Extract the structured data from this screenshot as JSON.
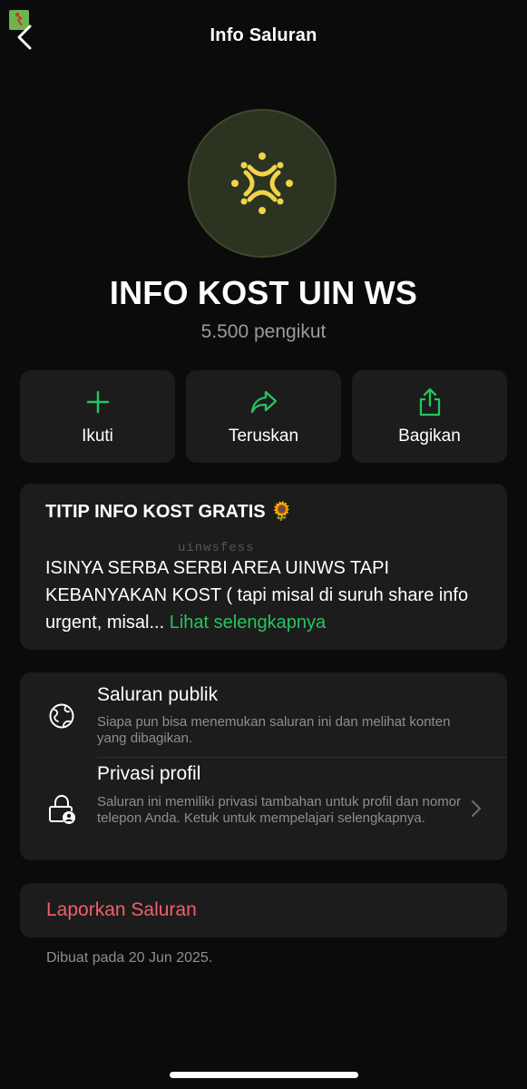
{
  "header": {
    "title": "Info Saluran"
  },
  "channel": {
    "name": "INFO KOST UIN WS",
    "followers": "5.500 pengikut"
  },
  "actions": [
    {
      "label": "Ikuti",
      "icon": "plus-icon"
    },
    {
      "label": "Teruskan",
      "icon": "forward-icon"
    },
    {
      "label": "Bagikan",
      "icon": "share-icon"
    }
  ],
  "description": {
    "title": "TITIP INFO KOST GRATIS 🌻",
    "watermark": "uinwsfess",
    "body": "ISINYA SERBA SERBI AREA UINWS TAPI KEBANYAKAN KOST ( tapi misal di suruh share info urgent, misal... ",
    "see_more": "Lihat selengkapnya"
  },
  "privacy": [
    {
      "title": "Saluran publik",
      "subtitle": "Siapa pun bisa menemukan saluran ini dan melihat konten yang dibagikan.",
      "icon": "globe-icon"
    },
    {
      "title": "Privasi profil",
      "subtitle": "Saluran ini memiliki privasi tambahan untuk profil dan nomor telepon Anda. Ketuk untuk mempelajari selengkapnya.",
      "icon": "lock-person-icon"
    }
  ],
  "report": {
    "label": "Laporkan Saluran"
  },
  "created": "Dibuat pada 20 Jun 2025.",
  "colors": {
    "background": "#0b0b0b",
    "card": "#1c1c1c",
    "accent_green": "#25c460",
    "danger_red": "#f0606a",
    "logo_yellow": "#f2d24a"
  }
}
